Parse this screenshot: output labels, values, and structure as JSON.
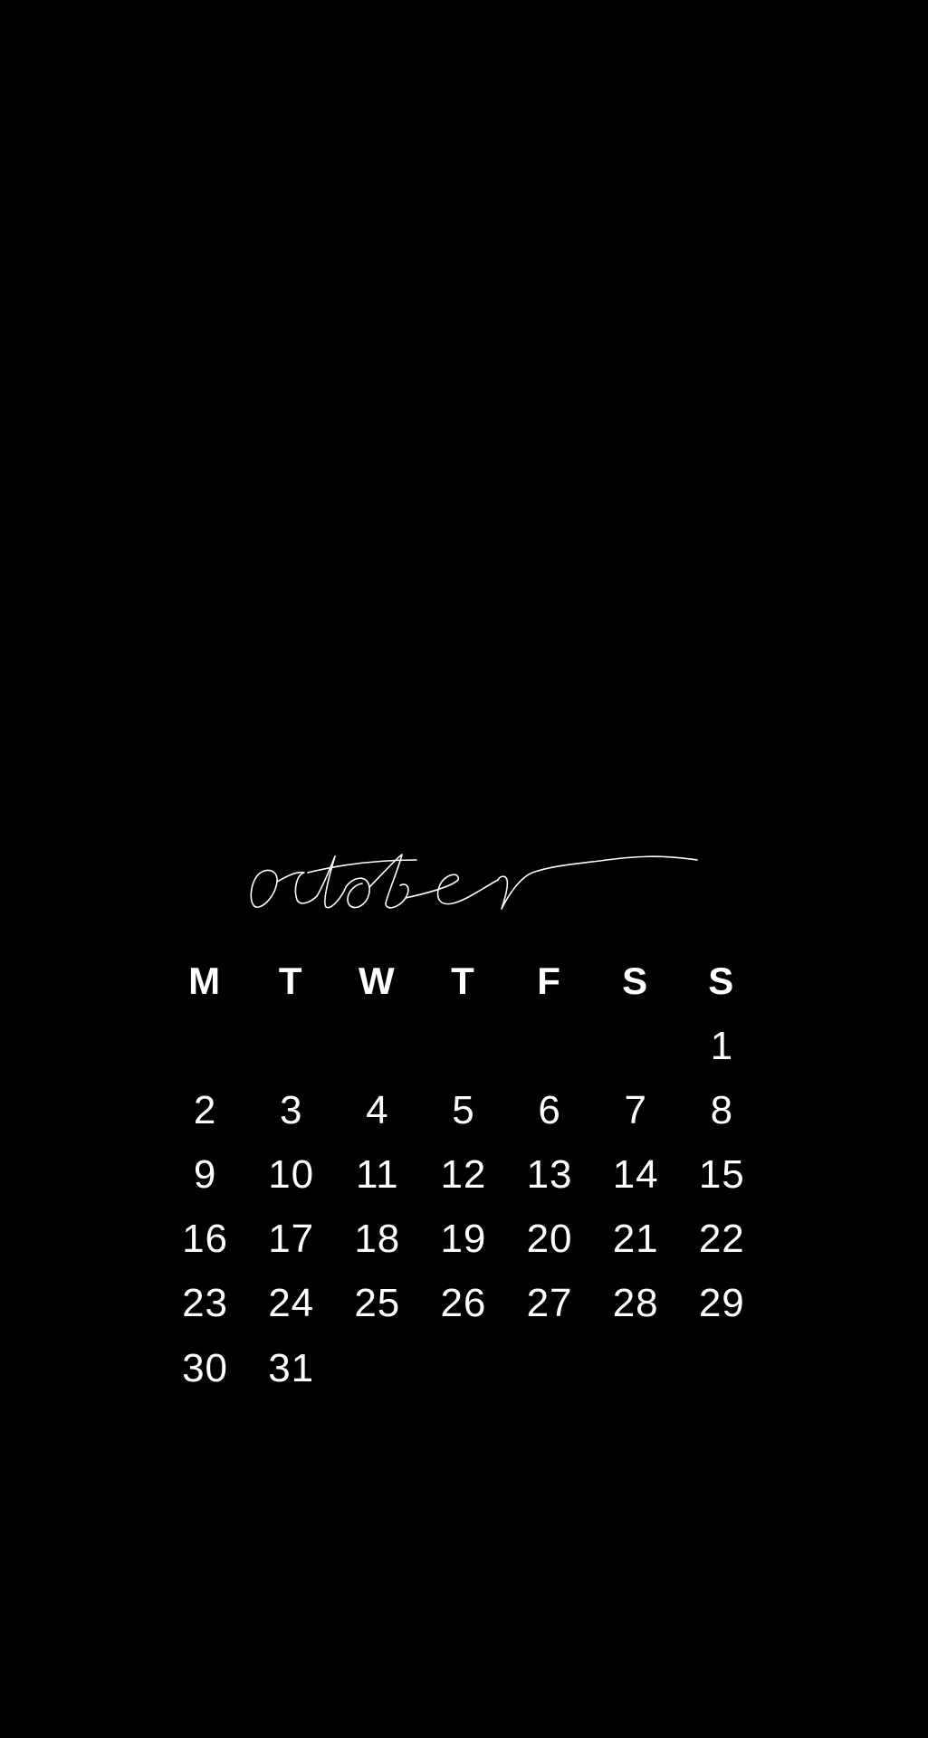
{
  "calendar": {
    "month": "october",
    "weekdays": [
      "M",
      "T",
      "W",
      "T",
      "F",
      "S",
      "S"
    ],
    "weeks": [
      [
        "",
        "",
        "",
        "",
        "",
        "",
        "1"
      ],
      [
        "2",
        "3",
        "4",
        "5",
        "6",
        "7",
        "8"
      ],
      [
        "9",
        "10",
        "11",
        "12",
        "13",
        "14",
        "15"
      ],
      [
        "16",
        "17",
        "18",
        "19",
        "20",
        "21",
        "22"
      ],
      [
        "23",
        "24",
        "25",
        "26",
        "27",
        "28",
        "29"
      ],
      [
        "30",
        "31",
        "",
        "",
        "",
        "",
        ""
      ]
    ]
  },
  "colors": {
    "background": "#000000",
    "text": "#ffffff"
  }
}
